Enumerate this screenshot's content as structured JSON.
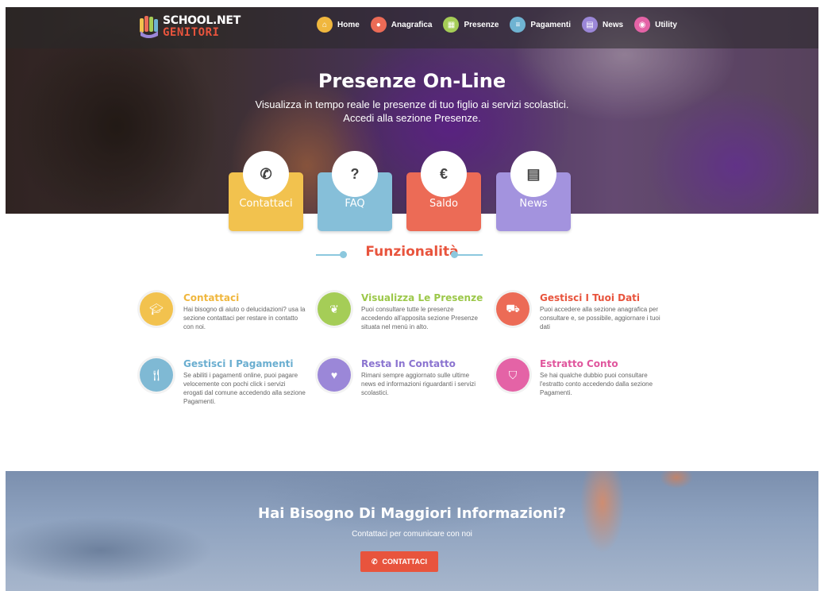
{
  "brand": {
    "line1": "SCHOOL.NET",
    "line2": "GENITORI"
  },
  "nav": [
    {
      "label": "Home",
      "icon": "home-icon",
      "color": "#f0b73e"
    },
    {
      "label": "Anagrafica",
      "icon": "user-icon",
      "color": "#ec6b56"
    },
    {
      "label": "Presenze",
      "icon": "calendar-icon",
      "color": "#a5cd57"
    },
    {
      "label": "Pagamenti",
      "icon": "list-icon",
      "color": "#6fb3d2"
    },
    {
      "label": "News",
      "icon": "newspaper-icon",
      "color": "#9b87d8"
    },
    {
      "label": "Utility",
      "icon": "eye-icon",
      "color": "#e463a6"
    }
  ],
  "hero": {
    "title": "Presenze On-Line",
    "subtitle1": "Visualizza in tempo reale le presenze di tuo figlio ai servizi scolastici.",
    "subtitle2": "Accedi alla sezione Presenze."
  },
  "cards": [
    {
      "label": "Contattaci",
      "icon": "phone-icon",
      "color": "#f2c24e"
    },
    {
      "label": "FAQ",
      "icon": "question-icon",
      "color": "#86bfd9"
    },
    {
      "label": "Saldo",
      "icon": "euro-icon",
      "color": "#ec6b56"
    },
    {
      "label": "News",
      "icon": "newspaper-icon",
      "color": "#a393de"
    }
  ],
  "section": {
    "title": "Funzionalità"
  },
  "features": [
    {
      "title": "Contattaci",
      "text": "Hai bisogno di aiuto o delucidazioni? usa la sezione contattaci per restare in contatto con noi.",
      "icon": "graduation-cap-icon",
      "color": "#f2c24e"
    },
    {
      "title": "Visualizza Le Presenze",
      "text": "Puoi consultare tutte le presenze accedendo all'apposita sezione Presenze situata nel menù in alto.",
      "icon": "leaf-icon",
      "color": "#a5cd57"
    },
    {
      "title": "Gestisci I Tuoi Dati",
      "text": "Puoi accedere alla sezione anagrafica per consultare e, se possibile, aggiornare i tuoi dati",
      "icon": "car-icon",
      "color": "#ec6b56"
    },
    {
      "title": "Gestisci I Pagamenti",
      "text": "Se abiliti i pagamenti online, puoi pagare velocemente con pochi click i servizi erogati dal comune accedendo alla sezione Pagamenti.",
      "icon": "cutlery-icon",
      "color": "#7fb9d4"
    },
    {
      "title": "Resta In Contatto",
      "text": "Rimani sempre aggiornato sulle ultime news ed informazioni riguardanti i servizi scolastici.",
      "icon": "heart-icon",
      "color": "#9b87d8"
    },
    {
      "title": "Estratto Conto",
      "text": "Se hai qualche dubbio puoi consultare l'estratto conto accedendo dalla sezione Pagamenti.",
      "icon": "shield-icon",
      "color": "#e463a6"
    }
  ],
  "banner": {
    "title": "Hai Bisogno Di Maggiori Informazioni?",
    "subtitle": "Contattaci per comunicare con noi",
    "button": "CONTATTACI"
  }
}
